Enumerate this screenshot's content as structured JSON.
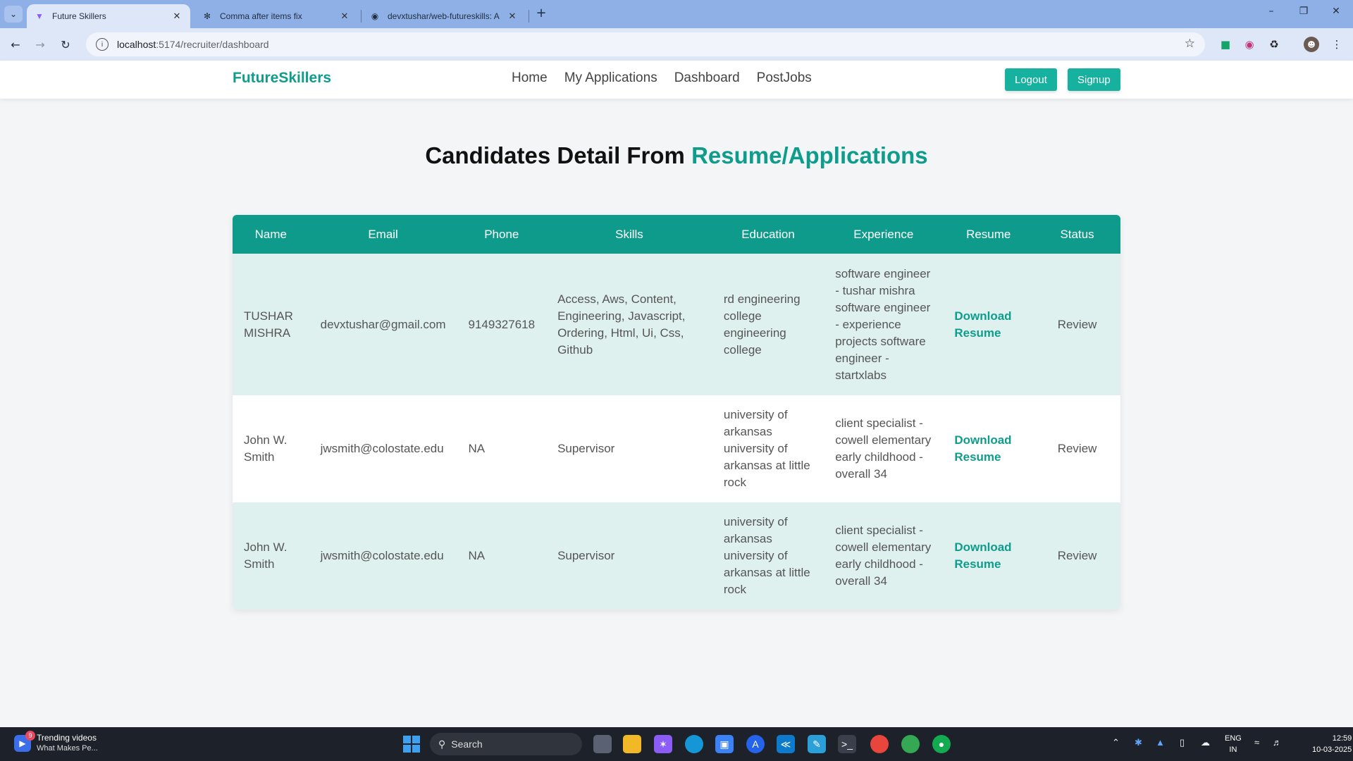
{
  "browser": {
    "tabs": [
      {
        "label": "Future Skillers",
        "active": true
      },
      {
        "label": "Comma after items fix",
        "active": false
      },
      {
        "label": "devxtushar/web-futureskills: A",
        "active": false
      }
    ],
    "url_host": "localhost",
    "url_rest": ":5174/recruiter/dashboard"
  },
  "app": {
    "brand": "FutureSkillers",
    "nav": [
      "Home",
      "My Applications",
      "Dashboard",
      "PostJobs"
    ],
    "logout_label": "Logout",
    "signup_label": "Signup",
    "accent_color": "#0f9c8c"
  },
  "page": {
    "title_part1": "Candidates Detail From ",
    "title_part2": "Resume/Applications"
  },
  "table": {
    "headers": [
      "Name",
      "Email",
      "Phone",
      "Skills",
      "Education",
      "Experience",
      "Resume",
      "Status"
    ],
    "rows": [
      {
        "name": "TUSHAR MISHRA",
        "email": "devxtushar@gmail.com",
        "phone": "9149327618",
        "skills": "Access, Aws, Content, Engineering, Javascript, Ordering, Html, Ui, Css, Github",
        "education": "rd engineering college engineering college",
        "experience": "software engineer - tushar mishra software engineer - experience projects software engineer - startxlabs",
        "resume": "Download Resume",
        "status": "Review"
      },
      {
        "name": "John W. Smith",
        "email": "jwsmith@colostate.edu",
        "phone": "NA",
        "skills": "Supervisor",
        "education": "university of arkansas university of arkansas at little rock",
        "experience": "client specialist - cowell elementary early childhood - overall 34",
        "resume": "Download Resume",
        "status": "Review"
      },
      {
        "name": "John W. Smith",
        "email": "jwsmith@colostate.edu",
        "phone": "NA",
        "skills": "Supervisor",
        "education": "university of arkansas university of arkansas at little rock",
        "experience": "client specialist - cowell elementary early childhood - overall 34",
        "resume": "Download Resume",
        "status": "Review"
      }
    ]
  },
  "taskbar": {
    "widget_badge": "9",
    "widget_title": "Trending videos",
    "widget_sub": "What Makes Pe...",
    "search_label": "Search",
    "lang_1": "ENG",
    "lang_2": "IN",
    "time": "12:59",
    "date": "10-03-2025"
  }
}
